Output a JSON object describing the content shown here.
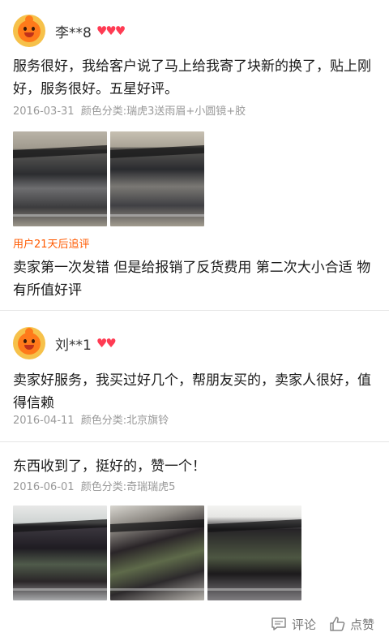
{
  "reviews": [
    {
      "username": "李**8",
      "hearts": [
        "♥",
        "♥",
        "♥"
      ],
      "text": "服务很好，我给客户说了马上给我寄了块新的换了，贴上刚好，服务很好。五星好评。",
      "date": "2016-03-31",
      "spec": "颜色分类:瑞虎3送雨眉+小圆镜+胶",
      "followup_label": "用户21天后追评",
      "followup_text": "卖家第一次发错  但是给报销了反货费用    第二次大小合适  物有所值好评"
    },
    {
      "username": "刘**1",
      "hearts": [
        "♥",
        "♥"
      ],
      "text": "卖家好服务，我买过好几个，帮朋友买的，卖家人很好，值得信赖",
      "date": "2016-04-11",
      "spec": "颜色分类:北京旗铃"
    },
    {
      "text": "东西收到了，挺好的，赞一个！",
      "date": "2016-06-01",
      "spec": "颜色分类:奇瑞瑞虎5"
    }
  ],
  "actions": {
    "comment_label": "评论",
    "like_label": "点赞"
  },
  "colors": {
    "followup": "#ff5a00",
    "meta": "#999999",
    "heart": "#ff3b53"
  }
}
